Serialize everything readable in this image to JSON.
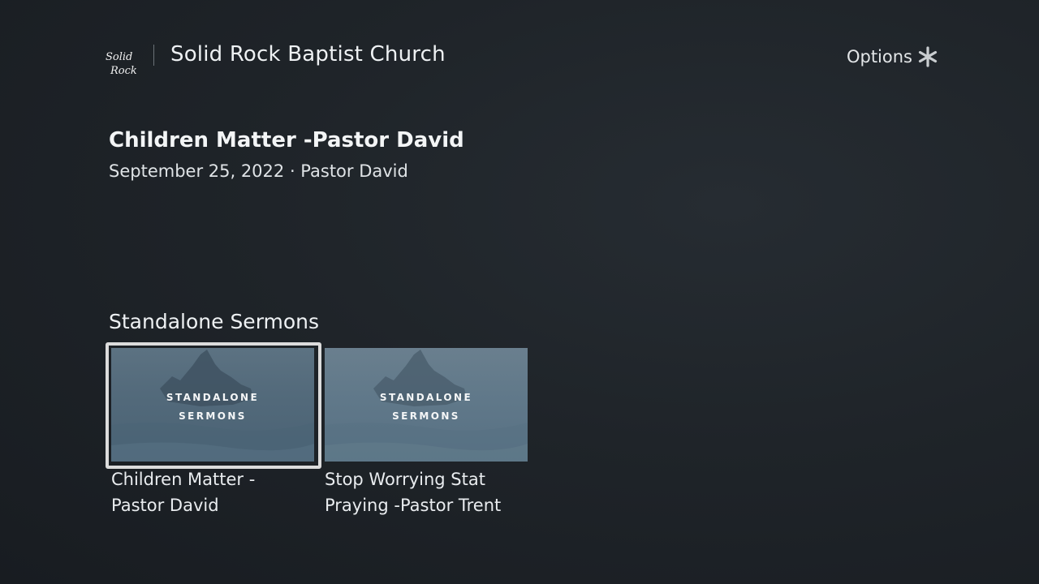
{
  "header": {
    "logo_text": "Solid Rock",
    "app_title": "Solid Rock Baptist Church",
    "options_label": "Options",
    "options_icon": "asterisk-icon"
  },
  "detail": {
    "title": "Children Matter -Pastor David",
    "meta": "September 25, 2022 · Pastor David"
  },
  "row": {
    "title": "Standalone Sermons",
    "items": [
      {
        "thumb_line1": "STANDALONE",
        "thumb_line2": "SERMONS",
        "label": "Children Matter -\nPastor David",
        "focused": true
      },
      {
        "thumb_line1": "STANDALONE",
        "thumb_line2": "SERMONS",
        "label": "Stop Worrying Stat\nPraying -Pastor Trent",
        "focused": false
      }
    ]
  },
  "colors": {
    "background": "#1f2429",
    "focus_ring": "#dcdcdc",
    "thumb_blue": "#536a7b"
  }
}
